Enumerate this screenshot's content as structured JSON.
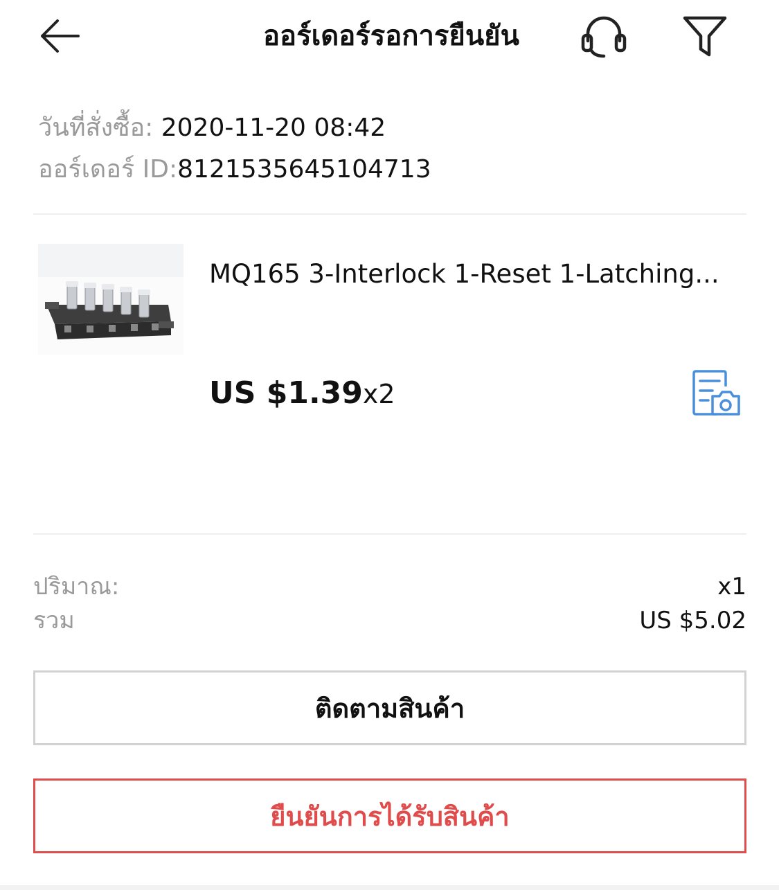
{
  "header": {
    "title": "ออร์เดอร์รอการยืนยัน",
    "back_icon": "arrow-left-icon",
    "support_icon": "headset-icon",
    "filter_icon": "filter-icon"
  },
  "order": {
    "date_label": "วันที่สั่งซื้อ: ",
    "date_value": "2020-11-20 08:42",
    "id_label": "ออร์เดอร์ ID:",
    "id_value": "8121535645104713"
  },
  "product": {
    "title": "MQ165 3-Interlock 1-Reset 1-Latching...",
    "price": "US $1.39",
    "quantity": "x2",
    "photo_review_icon": "document-camera-icon"
  },
  "summary": {
    "quantity_label": "ปริมาณ:",
    "quantity_value": "x1",
    "total_label": "รวม",
    "total_value": "US $5.02"
  },
  "buttons": {
    "track_label": "ติดตามสินค้า",
    "confirm_label": "ยืนยันการได้รับสินค้า"
  },
  "colors": {
    "accent_red": "#e04b4b",
    "icon_blue": "#4a8fdc",
    "label_gray": "#9a9a9a"
  }
}
